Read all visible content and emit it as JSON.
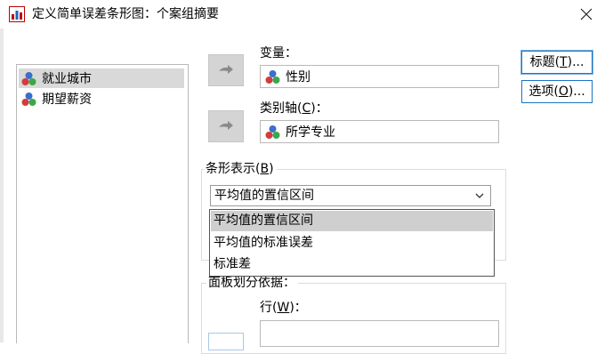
{
  "window": {
    "title": "定义简单误差条形图：个案组摘要"
  },
  "source_list": {
    "items": [
      {
        "label": "就业城市",
        "selected": true
      },
      {
        "label": "期望薪资",
        "selected": false
      }
    ]
  },
  "variable": {
    "label_text": "变量",
    "label_suffix": "：",
    "value": "性别"
  },
  "category_axis": {
    "label_text": "类别轴(",
    "mnemonic": "C",
    "label_end": ")：",
    "value": "所学专业"
  },
  "bars_represent": {
    "title_text": "条形表示(",
    "mnemonic": "B",
    "title_end": ")",
    "selected": "平均值的置信区间",
    "options": [
      "平均值的置信区间",
      "平均值的标准误差",
      "标准差"
    ]
  },
  "panel_by": {
    "title": "面板划分依据：",
    "rows_label_text": "行(",
    "rows_mnemonic": "W",
    "rows_label_end": ")："
  },
  "buttons": {
    "titles": {
      "text": "标题(",
      "mnemonic": "T",
      "end": ")..."
    },
    "options": {
      "text": "选项(",
      "mnemonic": "O",
      "end": ")..."
    }
  },
  "colors": {
    "accent": "#1a74c4",
    "selection": "#d9d9d9",
    "arrow_button": "#d4d4d4"
  }
}
